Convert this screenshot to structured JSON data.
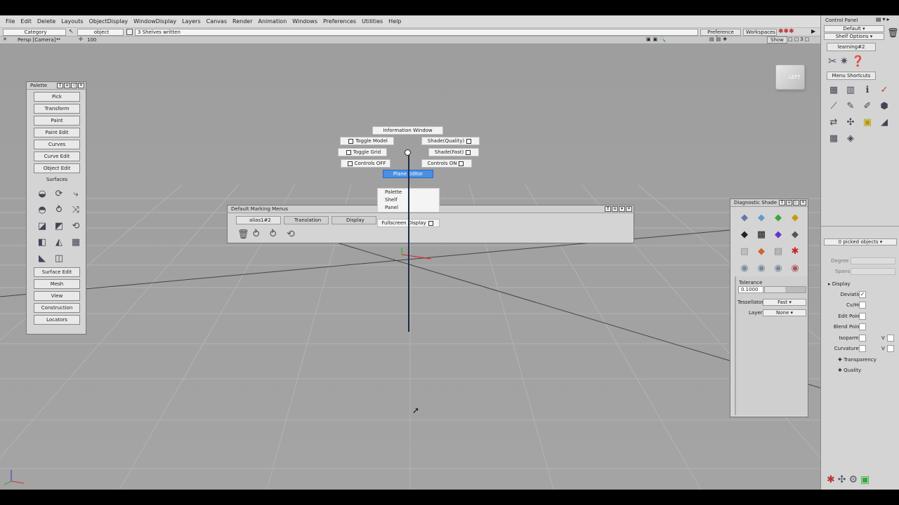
{
  "menu": [
    "File",
    "Edit",
    "Delete",
    "Layouts",
    "ObjectDisplay",
    "WindowDisplay",
    "Layers",
    "Canvas",
    "Render",
    "Animation",
    "Windows",
    "Preferences",
    "Utilities",
    "Help"
  ],
  "toolbar": {
    "category": "Category",
    "object": "object",
    "status": "3 Shelves written",
    "preference_sets": "Preference Sets",
    "workspaces": "Workspaces"
  },
  "viewbar": {
    "camera": "Persp [Camera]",
    "zoom": "100",
    "show": "Show"
  },
  "view_cube": {
    "face": "LEFT"
  },
  "palette": {
    "title": "Palette",
    "buttons_top": [
      "Pick",
      "Transform",
      "Paint",
      "Paint Edit",
      "Curves",
      "Curve Edit",
      "Object Edit"
    ],
    "surfaces_label": "Surfaces",
    "buttons_bottom": [
      "Surface Edit",
      "Mesh",
      "View",
      "Construction",
      "Locators"
    ],
    "icons": [
      "revolve-icon",
      "skin-icon",
      "extrude-icon",
      "loft-icon",
      "rail-icon",
      "boundary-icon",
      "square-icon",
      "planar-icon",
      "tube-icon",
      "offset-icon",
      "fillet-icon",
      "freeform-icon",
      "draft-icon",
      "plane-icon"
    ]
  },
  "marking_menu": {
    "title": "Default Marking Menus",
    "tabs": [
      "alias1#2",
      "Translation",
      "Display"
    ],
    "shelf_icons": [
      "trash-icon",
      "curve-tool-icon",
      "curve-tool-2-icon",
      "curve-tool-3-icon"
    ]
  },
  "radial_menu": {
    "information": "Information Window",
    "toggle_model": "Toggle Model",
    "shade_quality": "Shade(Quality)",
    "toggle_grid": "Toggle Grid",
    "shade_fast": "Shade(Fast)",
    "controls_off": "Controls OFF",
    "controls_on": "Controls ON",
    "plane_editor": "Plane Editor",
    "submenu": [
      "Palette",
      "Shelf",
      "Panel"
    ],
    "fullscreen": "Fullscreen Display"
  },
  "diagnostic": {
    "title": "Diagnostic Shade",
    "tolerance_label": "Tolerance",
    "tolerance_value": "0.1000",
    "tessellator_label": "Tessellator",
    "tessellator_value": "Fast",
    "layer_label": "Layer",
    "layer_value": "None"
  },
  "control_panel": {
    "title": "Control Panel",
    "layout": "Default",
    "shelf_options": "Shelf Options",
    "shelf_tab": "learning#2",
    "menu_shortcuts": "Menu Shortcuts",
    "picked": "0 picked objects",
    "degree": "Degree",
    "spans": "Spans",
    "display": "Display",
    "rows": [
      "Deviation",
      "Cv/Hull",
      "Edit Points",
      "Blend Points",
      "Isoparm U",
      "Curvature U"
    ],
    "v": "V",
    "transparency": "Transparency",
    "quality": "Quality"
  }
}
